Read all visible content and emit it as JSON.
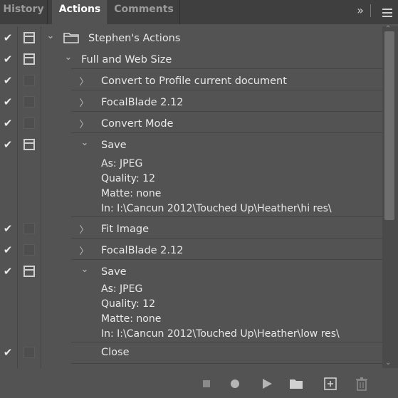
{
  "tabs": [
    {
      "label": "History",
      "active": false
    },
    {
      "label": "Actions",
      "active": true
    },
    {
      "label": "Comments",
      "active": false
    }
  ],
  "panel_menu": {
    "expand_icon": "double-chevron-right-icon",
    "menu_icon": "hamburger-menu-icon"
  },
  "rows": [
    {
      "label": "Stephen's Actions",
      "checked": true,
      "dialog": "on",
      "expanded": true,
      "level": 0,
      "type": "set"
    },
    {
      "label": "Full and Web Size",
      "checked": true,
      "dialog": "on",
      "expanded": true,
      "level": 1,
      "type": "action"
    },
    {
      "label": "Convert to Profile current document",
      "checked": true,
      "dialog": "off",
      "expanded": false,
      "level": 2
    },
    {
      "label": "FocalBlade 2.12",
      "checked": true,
      "dialog": "off",
      "expanded": false,
      "level": 2
    },
    {
      "label": "Convert Mode",
      "checked": true,
      "dialog": "off",
      "expanded": false,
      "level": 2
    },
    {
      "label": "Save",
      "checked": true,
      "dialog": "on",
      "expanded": true,
      "level": 2,
      "details": [
        "As: JPEG",
        "Quality: 12",
        "Matte: none",
        "In: I:\\Cancun 2012\\Touched Up\\Heather\\hi res\\"
      ]
    },
    {
      "label": "Fit Image",
      "checked": true,
      "dialog": "off",
      "expanded": false,
      "level": 2
    },
    {
      "label": "FocalBlade 2.12",
      "checked": true,
      "dialog": "off",
      "expanded": false,
      "level": 2
    },
    {
      "label": "Save",
      "checked": true,
      "dialog": "on",
      "expanded": true,
      "level": 2,
      "details": [
        "As: JPEG",
        "Quality: 12",
        "Matte: none",
        "In: I:\\Cancun 2012\\Touched Up\\Heather\\low res\\"
      ]
    },
    {
      "label": "Close",
      "checked": true,
      "dialog": "off",
      "expanded": null,
      "level": 2
    }
  ],
  "bottom_toolbar": [
    "stop-icon",
    "record-icon",
    "play-icon",
    "new-set-folder-icon",
    "new-action-icon",
    "delete-trash-icon"
  ],
  "colors": {
    "panel_bg": "#535353",
    "tabbar_bg": "#3f3f3f",
    "text": "#e6e6e6",
    "inactive_tab": "#9a9a9a"
  }
}
